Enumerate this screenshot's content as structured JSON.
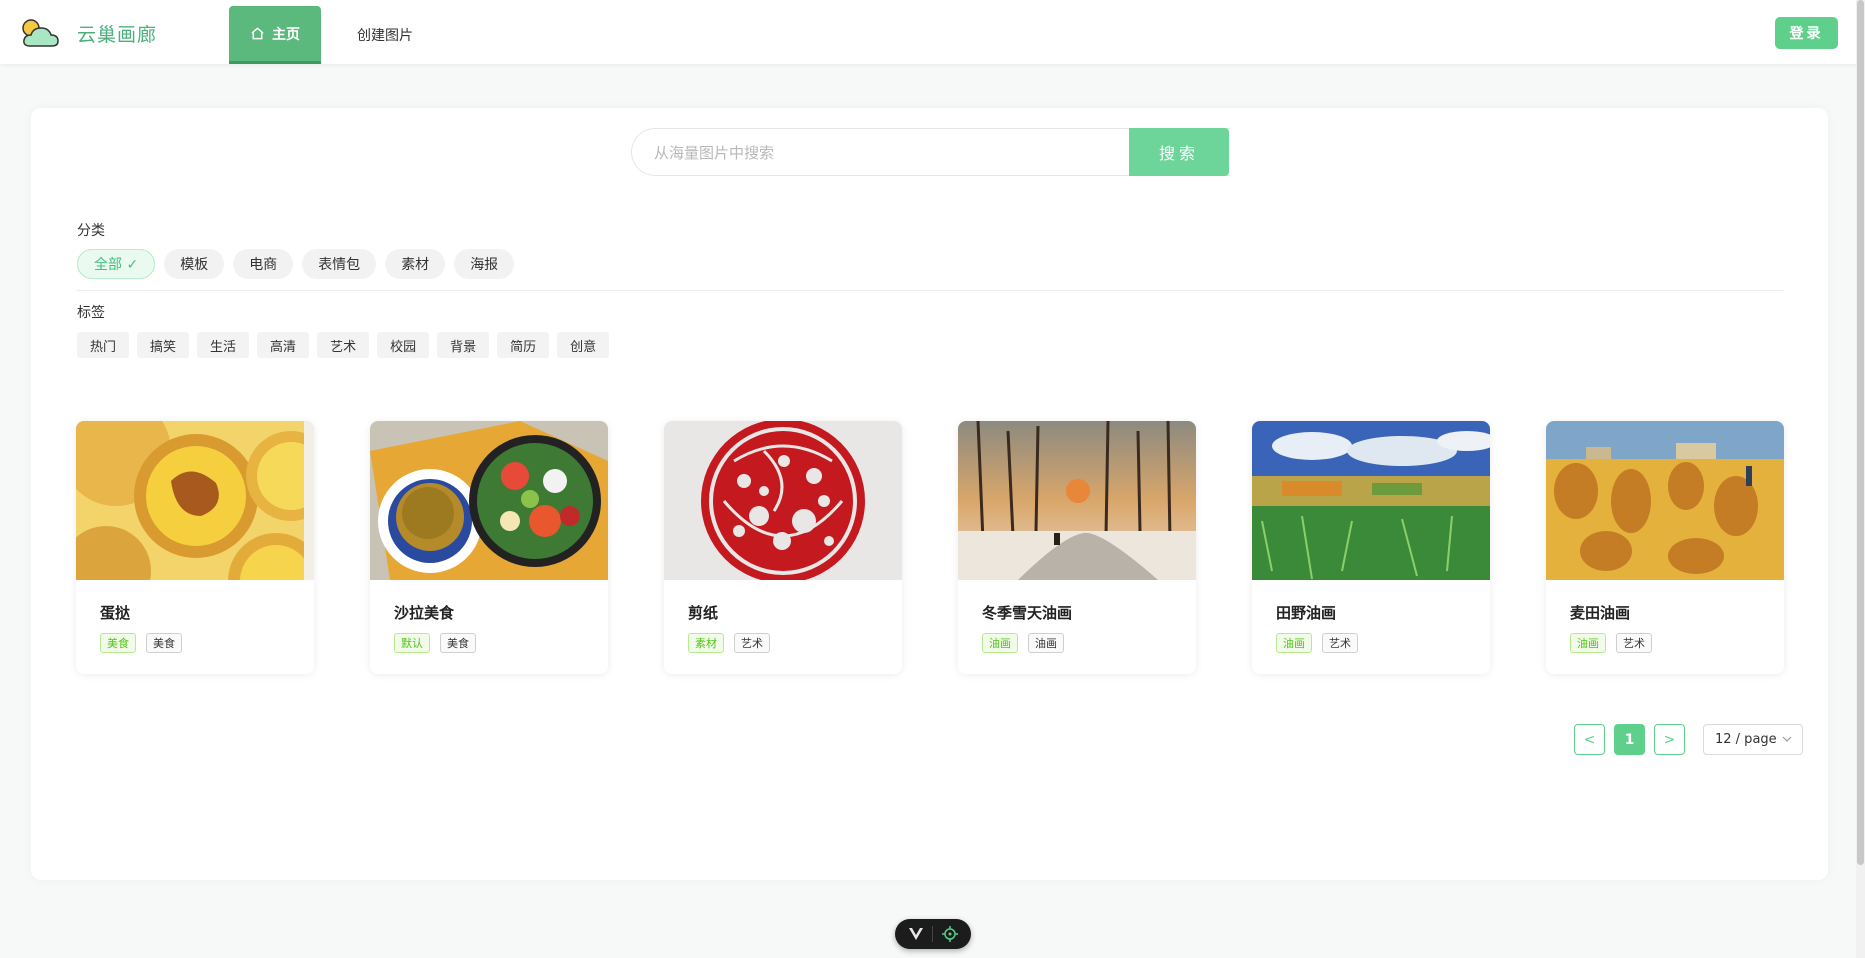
{
  "header": {
    "brand": "云巢画廊",
    "nav": {
      "home": "主页",
      "create": "创建图片"
    },
    "login": "登录"
  },
  "search": {
    "placeholder": "从海量图片中搜索",
    "button": "搜索"
  },
  "filters": {
    "category_label": "分类",
    "categories": [
      {
        "label": "全部 ✓",
        "active": true
      },
      {
        "label": "模板",
        "active": false
      },
      {
        "label": "电商",
        "active": false
      },
      {
        "label": "表情包",
        "active": false
      },
      {
        "label": "素材",
        "active": false
      },
      {
        "label": "海报",
        "active": false
      }
    ],
    "tag_label": "标签",
    "tags": [
      "热门",
      "搞笑",
      "生活",
      "高清",
      "艺术",
      "校园",
      "背景",
      "简历",
      "创意"
    ]
  },
  "cards": [
    {
      "title": "蛋挞",
      "tags": [
        "美食",
        "美食"
      ],
      "image": "egg-tart-photo"
    },
    {
      "title": "沙拉美食",
      "tags": [
        "默认",
        "美食"
      ],
      "image": "salad-photo"
    },
    {
      "title": "剪纸",
      "tags": [
        "素材",
        "艺术"
      ],
      "image": "paper-cut-phoenix"
    },
    {
      "title": "冬季雪天油画",
      "tags": [
        "油画",
        "油画"
      ],
      "image": "winter-oil-painting"
    },
    {
      "title": "田野油画",
      "tags": [
        "油画",
        "艺术"
      ],
      "image": "field-oil-painting"
    },
    {
      "title": "麦田油画",
      "tags": [
        "油画",
        "艺术"
      ],
      "image": "wheat-field-oil-painting"
    }
  ],
  "pagination": {
    "prev": "<",
    "current": "1",
    "next": ">",
    "page_size": "12 / page"
  },
  "colors": {
    "accent": "#5fd08b",
    "brand": "#4caf7d",
    "tag_green": "#52c41a"
  }
}
